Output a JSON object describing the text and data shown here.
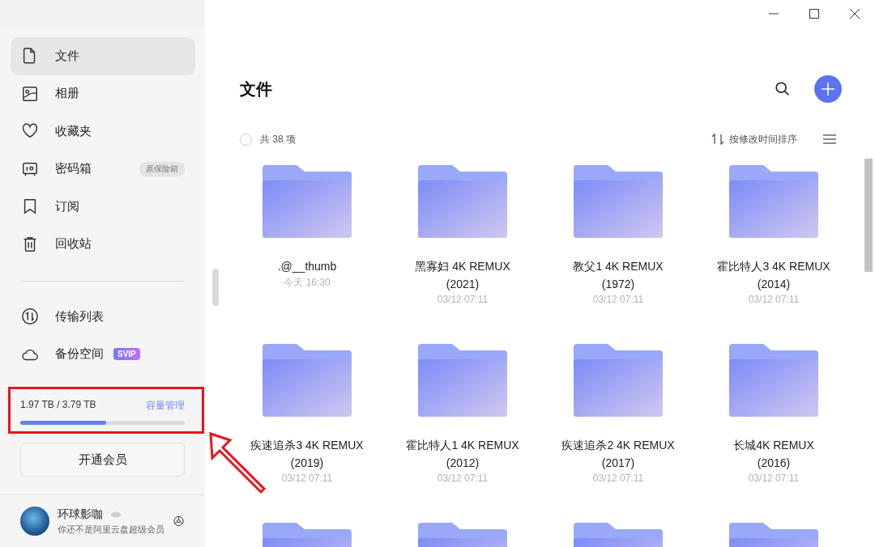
{
  "sidebar": {
    "items": [
      {
        "label": "文件",
        "kind": "file",
        "selected": true
      },
      {
        "label": "相册",
        "kind": "photo",
        "selected": false
      },
      {
        "label": "收藏夹",
        "kind": "heart",
        "selected": false
      },
      {
        "label": "密码箱",
        "kind": "safe",
        "selected": false,
        "tag": "原保险箱"
      },
      {
        "label": "订阅",
        "kind": "bookmark",
        "selected": false
      },
      {
        "label": "回收站",
        "kind": "trash",
        "selected": false
      }
    ],
    "lower_items": [
      {
        "label": "传输列表",
        "kind": "transfer",
        "selected": false
      },
      {
        "label": "备份空间",
        "kind": "cloud",
        "selected": false,
        "tag": "SVIP"
      }
    ],
    "storage": {
      "usage": "1.97 TB / 3.79 TB",
      "manage_link": "容量管理",
      "level": 0.52
    },
    "upgrade_button": "开通会员",
    "profile": {
      "name": "环球影咖",
      "subtitle": "你还不是阿里云盘超级会员"
    }
  },
  "main": {
    "title": "文件",
    "select_all": {
      "checked": false
    },
    "count": "共 38 项",
    "sort": "按修改时间排序",
    "items": [
      {
        "kind": "folder",
        "name": ".@__thumb",
        "date": "今天 16:30"
      },
      {
        "kind": "folder",
        "name": "黑寡妇 4K REMUX (2021)",
        "date": "03/12 07:11"
      },
      {
        "kind": "folder",
        "name": "教父1 4K REMUX (1972)",
        "date": "03/12 07:11"
      },
      {
        "kind": "folder",
        "name": "霍比特人3 4K REMUX (2014)",
        "date": "03/12 07:11"
      },
      {
        "kind": "folder",
        "name": "疾速追杀3 4K REMUX (2019)",
        "date": "03/12 07:11"
      },
      {
        "kind": "folder",
        "name": "霍比特人1 4K REMUX (2012)",
        "date": "03/12 07:11"
      },
      {
        "kind": "folder",
        "name": "疾速追杀2 4K REMUX (2017)",
        "date": "03/12 07:11"
      },
      {
        "kind": "folder",
        "name": "长城4K REMUX (2016)",
        "date": "03/12 07:11"
      },
      {
        "kind": "folder"
      },
      {
        "kind": "folder"
      },
      {
        "kind": "folder"
      },
      {
        "kind": "folder"
      }
    ]
  }
}
